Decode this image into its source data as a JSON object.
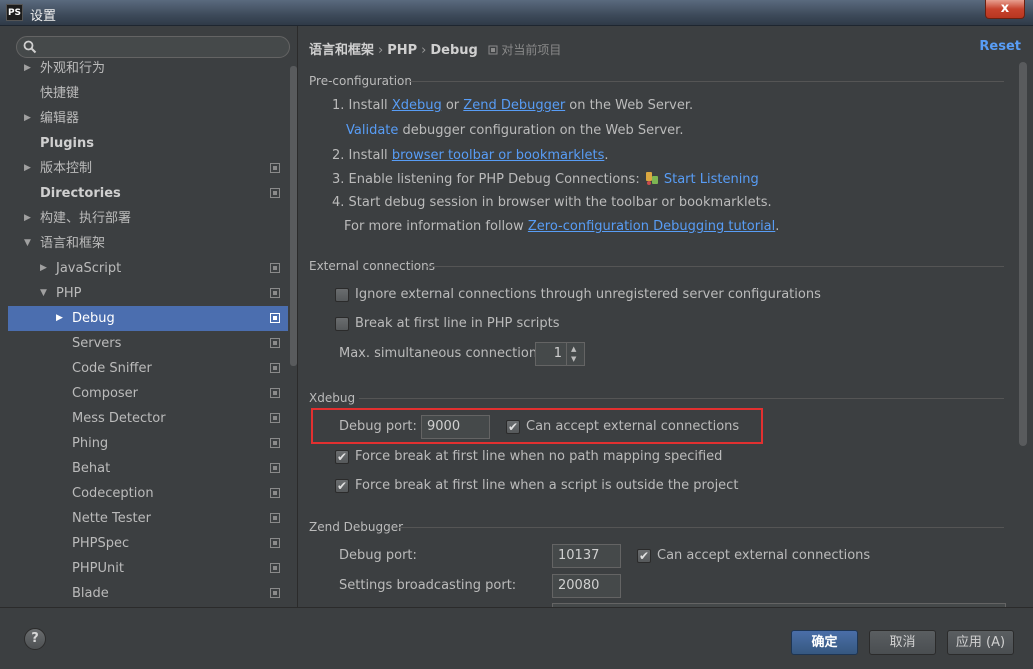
{
  "window": {
    "app_icon": "PS",
    "title": "设置",
    "close_glyph": "x"
  },
  "search": {
    "placeholder": ""
  },
  "tree": [
    {
      "label": "外观和行为",
      "arrow": "▶",
      "indent": 0,
      "bold": false,
      "copy": false,
      "selected": false
    },
    {
      "label": "快捷键",
      "arrow": "",
      "indent": 0,
      "bold": false,
      "copy": false,
      "selected": false
    },
    {
      "label": "编辑器",
      "arrow": "▶",
      "indent": 0,
      "bold": false,
      "copy": false,
      "selected": false
    },
    {
      "label": "Plugins",
      "arrow": "",
      "indent": 0,
      "bold": true,
      "copy": false,
      "selected": false
    },
    {
      "label": "版本控制",
      "arrow": "▶",
      "indent": 0,
      "bold": false,
      "copy": true,
      "selected": false
    },
    {
      "label": "Directories",
      "arrow": "",
      "indent": 0,
      "bold": true,
      "copy": true,
      "selected": false
    },
    {
      "label": "构建、执行部署",
      "arrow": "▶",
      "indent": 0,
      "bold": false,
      "copy": false,
      "selected": false
    },
    {
      "label": "语言和框架",
      "arrow": "▼",
      "indent": 0,
      "bold": false,
      "copy": false,
      "selected": false
    },
    {
      "label": "JavaScript",
      "arrow": "▶",
      "indent": 1,
      "bold": false,
      "copy": true,
      "selected": false
    },
    {
      "label": "PHP",
      "arrow": "▼",
      "indent": 1,
      "bold": false,
      "copy": true,
      "selected": false
    },
    {
      "label": "Debug",
      "arrow": "▶",
      "indent": 2,
      "bold": false,
      "copy": true,
      "selected": true
    },
    {
      "label": "Servers",
      "arrow": "",
      "indent": 2,
      "bold": false,
      "copy": true,
      "selected": false
    },
    {
      "label": "Code Sniffer",
      "arrow": "",
      "indent": 2,
      "bold": false,
      "copy": true,
      "selected": false
    },
    {
      "label": "Composer",
      "arrow": "",
      "indent": 2,
      "bold": false,
      "copy": true,
      "selected": false
    },
    {
      "label": "Mess Detector",
      "arrow": "",
      "indent": 2,
      "bold": false,
      "copy": true,
      "selected": false
    },
    {
      "label": "Phing",
      "arrow": "",
      "indent": 2,
      "bold": false,
      "copy": true,
      "selected": false
    },
    {
      "label": "Behat",
      "arrow": "",
      "indent": 2,
      "bold": false,
      "copy": true,
      "selected": false
    },
    {
      "label": "Codeception",
      "arrow": "",
      "indent": 2,
      "bold": false,
      "copy": true,
      "selected": false
    },
    {
      "label": "Nette Tester",
      "arrow": "",
      "indent": 2,
      "bold": false,
      "copy": true,
      "selected": false
    },
    {
      "label": "PHPSpec",
      "arrow": "",
      "indent": 2,
      "bold": false,
      "copy": true,
      "selected": false
    },
    {
      "label": "PHPUnit",
      "arrow": "",
      "indent": 2,
      "bold": false,
      "copy": true,
      "selected": false
    },
    {
      "label": "Blade",
      "arrow": "",
      "indent": 2,
      "bold": false,
      "copy": true,
      "selected": false
    }
  ],
  "breadcrumb": {
    "part1": "语言和框架",
    "sep": "›",
    "part2": "PHP",
    "part3": "Debug",
    "scope": "对当前项目"
  },
  "reset_label": "Reset",
  "preconfig": {
    "title": "Pre-configuration",
    "step1_prefix": "1. Install ",
    "step1_link1": "Xdebug",
    "step1_mid": " or ",
    "step1_link2": "Zend Debugger",
    "step1_suffix": " on the Web Server.",
    "validate_link": "Validate",
    "validate_suffix": " debugger configuration on the Web Server.",
    "step2_prefix": "2. Install ",
    "step2_link": "browser toolbar or bookmarklets",
    "step2_suffix": ".",
    "step3_prefix": "3. Enable listening for PHP Debug Connections: ",
    "step3_link": "Start Listening",
    "step4": "4. Start debug session in browser with the toolbar or bookmarklets.",
    "more_prefix": "For more information follow ",
    "more_link": "Zero-configuration Debugging tutorial",
    "more_suffix": "."
  },
  "external": {
    "title": "External connections",
    "ignore_label": "Ignore external connections through unregistered server configurations",
    "ignore_checked": false,
    "break_label": "Break at first line in PHP scripts",
    "break_checked": false,
    "max_label": "Max. simultaneous connections:",
    "max_value": "1"
  },
  "xdebug": {
    "title": "Xdebug",
    "port_label": "Debug port:",
    "port_value": "9000",
    "accept_label": "Can accept external connections",
    "accept_checked": true,
    "force1_label": "Force break at first line when no path mapping specified",
    "force1_checked": true,
    "force2_label": "Force break at first line when a script is outside the project",
    "force2_checked": true
  },
  "zend": {
    "title": "Zend Debugger",
    "port_label": "Debug port:",
    "port_value": "10137",
    "accept_label": "Can accept external connections",
    "accept_checked": true,
    "broadcast_label": "Settings broadcasting port:",
    "broadcast_value": "20080"
  },
  "buttons": {
    "help": "?",
    "ok": "确定",
    "cancel": "取消",
    "apply": "应用 (A)"
  },
  "colors": {
    "selection": "#4b6eaf",
    "link": "#589df6",
    "highlight": "#e23030",
    "background": "#3c3f41"
  }
}
